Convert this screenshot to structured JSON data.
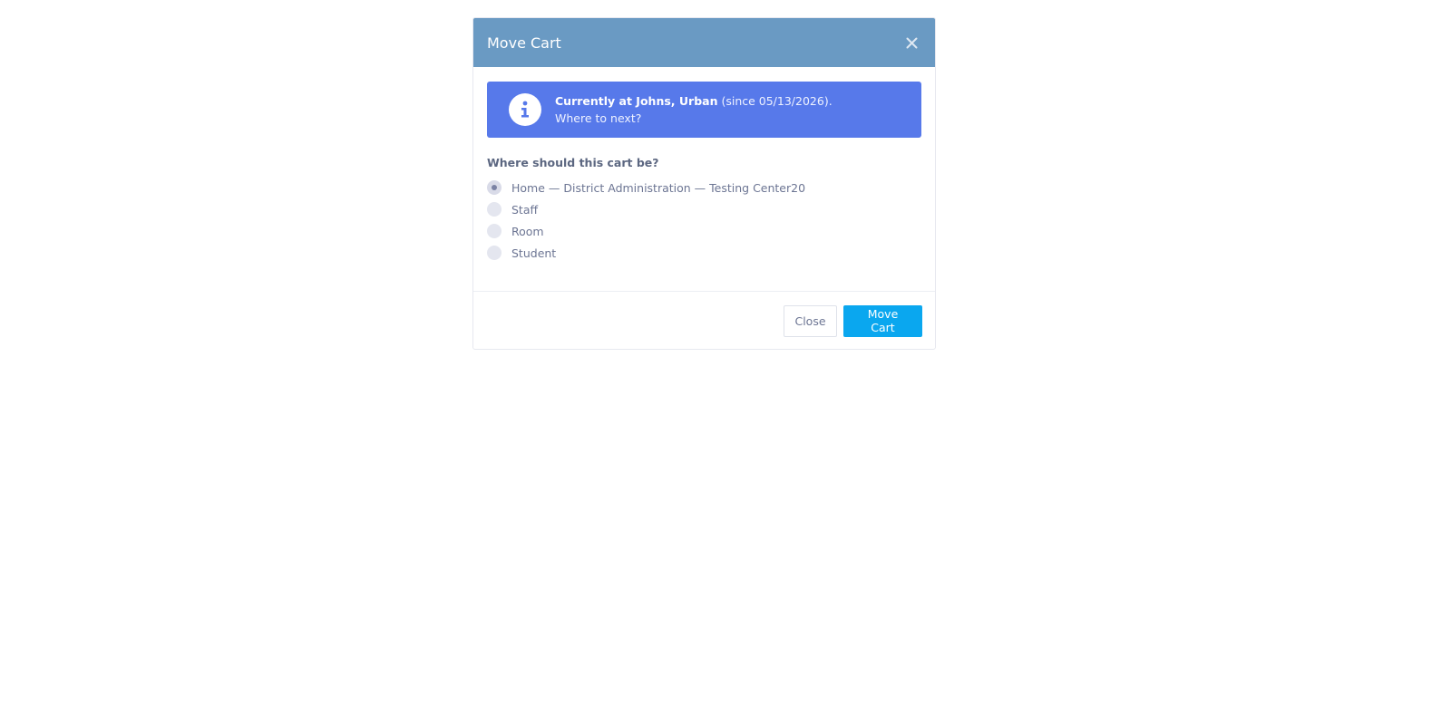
{
  "modal": {
    "title": "Move Cart",
    "close_icon": "close-icon"
  },
  "alert": {
    "icon": "info-icon",
    "strong_text": "Currently at Johns, Urban",
    "since_text": " (since 05/13/2026).",
    "second_line": "Where to next?"
  },
  "form": {
    "question": "Where should this cart be?",
    "options": [
      {
        "label": "Home — District Administration — Testing Center20",
        "selected": true
      },
      {
        "label": "Staff",
        "selected": false
      },
      {
        "label": "Room",
        "selected": false
      },
      {
        "label": "Student",
        "selected": false
      }
    ]
  },
  "footer": {
    "close_label": "Close",
    "submit_label": "Move Cart"
  },
  "colors": {
    "header": "#6a9ac3",
    "alert": "#5779ea",
    "primary": "#0aa7ef"
  }
}
